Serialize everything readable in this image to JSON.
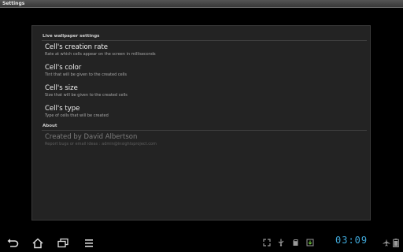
{
  "window": {
    "title": "Settings"
  },
  "sections": {
    "live_wallpaper": {
      "header": "Live wallpaper settings"
    },
    "about": {
      "header": "About"
    }
  },
  "prefs": [
    {
      "title": "Cell's creation rate",
      "summary": "Rate at which cells appear on the screen in milliseconds"
    },
    {
      "title": "Cell's color",
      "summary": "Tint that will be given to the created cells"
    },
    {
      "title": "Cell's size",
      "summary": "Size that will be given to the created cells"
    },
    {
      "title": "Cell's type",
      "summary": "Type of cells that will be created"
    }
  ],
  "about": {
    "title": "Created by David Albertson",
    "summary": "Report bugs or email ideas : admin@insightsproject.com"
  },
  "statusbar": {
    "time": "03:09",
    "accent": "#3fa7d8",
    "icons": [
      "fullscreen-icon",
      "usb-debug-icon",
      "sd-card-icon",
      "download-icon",
      "airplane-mode-icon",
      "battery-icon"
    ]
  },
  "navigation": {
    "buttons": [
      "back-icon",
      "home-icon",
      "recent-apps-icon",
      "menu-icon"
    ]
  }
}
